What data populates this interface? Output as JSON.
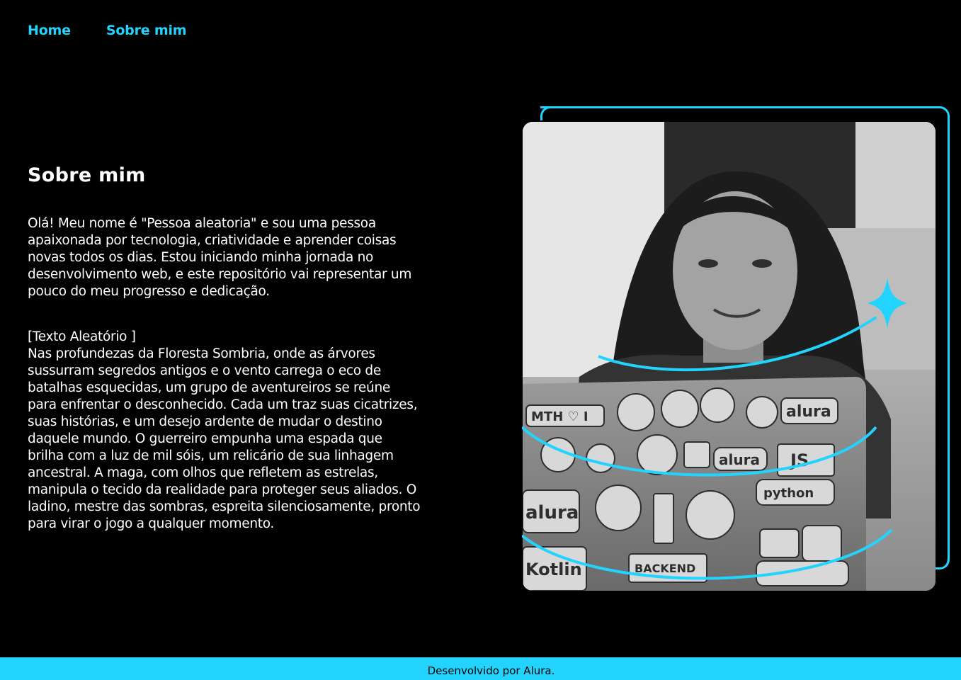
{
  "nav": {
    "items": [
      {
        "label": "Home"
      },
      {
        "label": "Sobre mim"
      }
    ]
  },
  "main": {
    "title": "Sobre mim",
    "intro_lines": [
      "Olá! Meu nome é \"Pessoa aleatoria\" e sou uma pessoa",
      "apaixonada por tecnologia, criatividade e aprender coisas",
      "novas todos os dias. Estou iniciando minha jornada no",
      "desenvolvimento web, e este repositório vai representar um",
      "pouco do meu progresso e dedicação."
    ],
    "story_lines": [
      "[Texto Aleatório ]",
      "Nas profundezas da Floresta Sombria, onde as árvores",
      "sussurram segredos antigos e o vento carrega o eco de",
      "batalhas esquecidas, um grupo de aventureiros se reúne",
      "para enfrentar o desconhecido. Cada um traz suas cicatrizes,",
      "suas histórias, e um desejo ardente de mudar o destino",
      "daquele mundo. O guerreiro empunha uma espada que",
      "brilha com a luz de mil sóis, um relicário de sua linhagem",
      "ancestral. A maga, com olhos que refletem as estrelas,",
      "manipula o tecido da realidade para proteger seus aliados. O",
      "ladino, mestre das sombras, espreita silenciosamente, pronto",
      "para virar o jogo a qualquer momento."
    ],
    "photo": {
      "icon": "portrait-photo",
      "sticker_texts": [
        "MTH ♡ I",
        "alura",
        "alura",
        "JS",
        "python",
        "alura",
        "BACKEND",
        "Kotlin"
      ]
    }
  },
  "footer": {
    "text": "Desenvolvido por Alura."
  },
  "colors": {
    "accent": "#22d4fd",
    "background": "#000000",
    "text": "#ffffff"
  }
}
